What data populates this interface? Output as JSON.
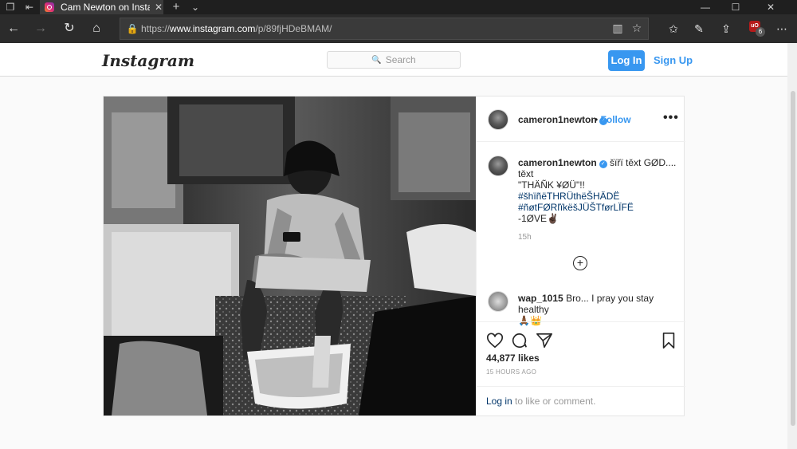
{
  "browser": {
    "tab_title": "Cam Newton on Instagr",
    "tab_close": "✕",
    "new_tab": "+",
    "tab_list": "⌄",
    "url_prefix": "https://",
    "url_domain": "www.instagram.com",
    "url_path": "/p/89fjHDeBMAM/",
    "extension_label": "uO",
    "extension_badge": "6"
  },
  "header": {
    "logo": "Instagram",
    "search_placeholder": "Search",
    "login_label": "Log In",
    "signup_label": "Sign Up"
  },
  "post": {
    "username": "cameron1newton",
    "follow_label": "Follow",
    "follow_sep": "•",
    "more": "•••",
    "caption_lines": [
      "šïřï těxt GØD....",
      "těxt",
      "\"THÄÑK ¥ØÜ\"!!",
      "#šhïñëTHRÜthëŠHÄDË",
      "#ñøtFØRľïkëšJÜŠTførLÏFË",
      "-1ØVE✌🏿"
    ],
    "caption_time": "15h",
    "comment": {
      "username": "wap_1015",
      "text": "Bro... I pray you stay healthy",
      "emoji": "🙏🏾👑"
    },
    "likes": "44,877 likes",
    "time_ago": "15 HOURS AGO",
    "login_link": "Log in",
    "login_suffix": "to like or comment."
  }
}
